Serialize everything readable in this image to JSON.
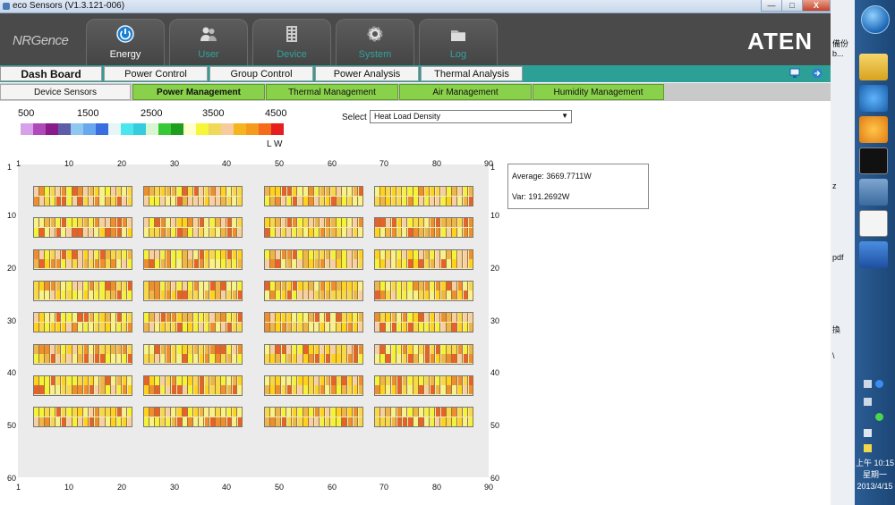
{
  "window": {
    "title": "eco Sensors (V1.3.121-006)",
    "minimize": "—",
    "maximize": "□",
    "close": "X"
  },
  "header": {
    "logo": "NRGence",
    "brand": "ATEN",
    "tabs": [
      {
        "label": "Energy",
        "icon": "energy-icon",
        "active": true
      },
      {
        "label": "User",
        "icon": "user-icon",
        "active": false
      },
      {
        "label": "Device",
        "icon": "device-icon",
        "active": false
      },
      {
        "label": "System",
        "icon": "system-gear-icon",
        "active": false
      },
      {
        "label": "Log",
        "icon": "log-icon",
        "active": false
      }
    ]
  },
  "menu": {
    "items": [
      {
        "label": "Dash Board",
        "active": true
      },
      {
        "label": "Power Control",
        "active": false
      },
      {
        "label": "Group Control",
        "active": false
      },
      {
        "label": "Power Analysis",
        "active": false
      },
      {
        "label": "Thermal Analysis",
        "active": false
      }
    ],
    "icons": [
      "monitor-icon",
      "logout-icon"
    ]
  },
  "subtabs": {
    "items": [
      {
        "label": "Device Sensors",
        "active": false
      },
      {
        "label": "Power Management",
        "active": true
      },
      {
        "label": "Thermal Management",
        "active": false
      },
      {
        "label": "Air Management",
        "active": false
      },
      {
        "label": "Humidity Management",
        "active": false
      }
    ]
  },
  "legend": {
    "labels": [
      "500",
      "1500",
      "2500",
      "3500",
      "4500"
    ],
    "unit": "L W",
    "colors": [
      "#d6a1e8",
      "#b04ab8",
      "#8a1b8a",
      "#5e5ea8",
      "#8ec8ee",
      "#6aa8ee",
      "#3a6ee0",
      "#e6f6f6",
      "#4ae6ee",
      "#36cce0",
      "#d8f6d0",
      "#36c836",
      "#1e9e1e",
      "#ffffcc",
      "#f6f63a",
      "#f0d85a",
      "#f6cc9e",
      "#f6b41e",
      "#f69a1e",
      "#f66a1e",
      "#e61e1e"
    ]
  },
  "select": {
    "label": "Select",
    "value": "Heat Load Density"
  },
  "map": {
    "x_ticks": [
      "1",
      "10",
      "20",
      "30",
      "40",
      "50",
      "60",
      "70",
      "80",
      "90"
    ],
    "y_ticks": [
      "1",
      "10",
      "20",
      "30",
      "40",
      "50",
      "60"
    ],
    "cell_colors": [
      "#f3f33a",
      "#f6d84a",
      "#eeb54a",
      "#f7cfa6",
      "#ef8e2e",
      "#f6f38a",
      "#ffd21e",
      "#e8612a"
    ]
  },
  "stats": {
    "average": "Average: 3669.7711W",
    "variance": "Var: 191.2692W"
  },
  "desktop": {
    "strip_texts": [
      "備份",
      "b...",
      "z",
      "pdf",
      "換",
      "\\"
    ],
    "clock_time": "上午 10:15",
    "clock_day": "星期一",
    "clock_date": "2013/4/15"
  }
}
